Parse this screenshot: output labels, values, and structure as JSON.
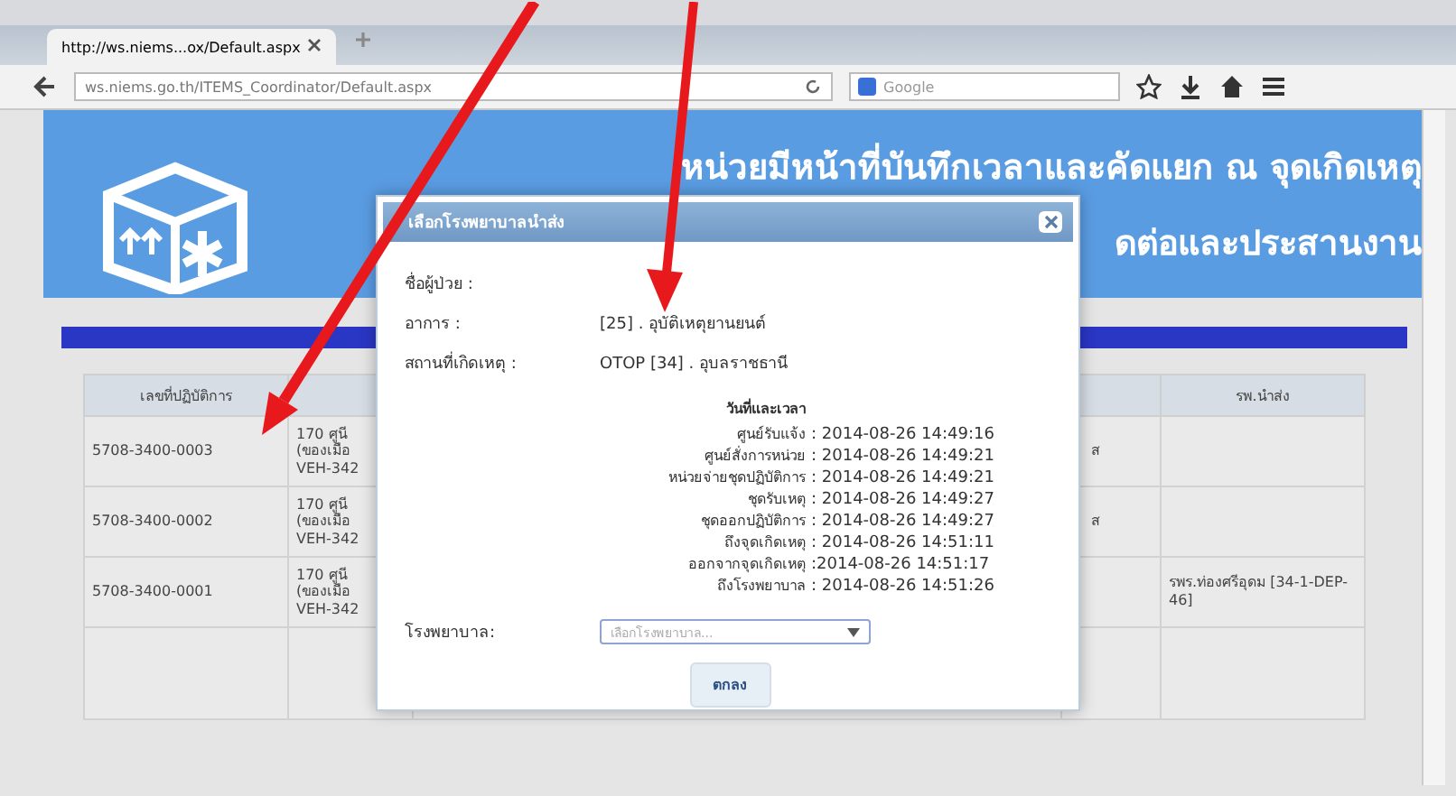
{
  "browser": {
    "tab_title": "http://ws.niems...ox/Default.aspx",
    "url": "ws.niems.go.th/ITEMS_Coordinator/Default.aspx",
    "search_placeholder": "Google"
  },
  "header": {
    "title": "หน่วยมีหน้าที่บันทึกเวลาและคัดแยก ณ จุดเกิดเหตุ",
    "subtitle": "ดต่อและประสานงาน"
  },
  "table": {
    "columns": [
      "เลขที่ปฏิบัติการ",
      "",
      "",
      "",
      "รพ.นำส่ง"
    ],
    "rows": [
      {
        "cells": [
          "5708-3400-0003",
          "170 ศูนี\n(ของเมือ\nVEH-342",
          "",
          "ส",
          ""
        ]
      },
      {
        "cells": [
          "5708-3400-0002",
          "170 ศูนี\n(ของเมือ\nVEH-342",
          "",
          "ส",
          ""
        ]
      },
      {
        "cells": [
          "5708-3400-0001",
          "170 ศูนี\n(ของเมือ\nVEH-342",
          "",
          "",
          "รพร.ท่องศรีอุดม [34-1-DEP-46]"
        ]
      }
    ]
  },
  "dialog": {
    "title": "เลือกโรงพยาบาลนำส่ง",
    "fields": [
      {
        "label": "ชื่อผู้ป่วย :"
      },
      {
        "label": "อาการ :",
        "value": "[25] . อุบัติเหตุยานยนต์"
      },
      {
        "label": "สถานที่เกิดเหตุ :",
        "value": "OTOP [34] . อุบลราชธานี"
      }
    ],
    "times_heading": "วันที่และเวลา",
    "times": [
      {
        "label": "ศูนย์รับแจ้ง",
        "value": ": 2014-08-26 14:49:16"
      },
      {
        "label": "ศูนย์สั่งการหน่วย",
        "value": ": 2014-08-26 14:49:21"
      },
      {
        "label": "หน่วยจ่ายชุดปฏิบัติการ",
        "value": ": 2014-08-26 14:49:21"
      },
      {
        "label": "ชุดรับเหตุ",
        "value": ": 2014-08-26 14:49:27"
      },
      {
        "label": "ชุดออกปฏิบัติการ",
        "value": ": 2014-08-26 14:49:27"
      },
      {
        "label": "ถึงจุดเกิดเหตุ",
        "value": ": 2014-08-26 14:51:11"
      },
      {
        "label": "ออกจากจุดเกิดเหตุ",
        "value": ":2014-08-26 14:51:17"
      },
      {
        "label": "ถึงโรงพยาบาล",
        "value": ": 2014-08-26 14:51:26"
      }
    ],
    "hospital_label": "โรงพยาบาล:",
    "hospital_placeholder": "เลือกโรงพยาบาล...",
    "ok_button": "ตกลง"
  }
}
